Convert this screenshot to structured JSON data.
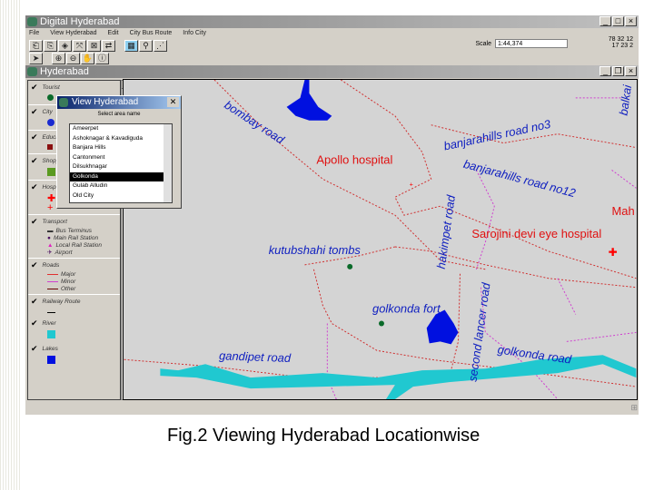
{
  "app": {
    "title": "Digital Hyderabad",
    "menu": [
      "File",
      "View Hyderabad",
      "Edit",
      "City Bus Route",
      "Info City"
    ],
    "scale_label": "Scale",
    "scale_value": "1:44,374",
    "coords": [
      "78 32 12",
      "17 23 2"
    ]
  },
  "subwindow": {
    "title": "Hyderabad"
  },
  "legend": {
    "groups": [
      {
        "label": "Tourist",
        "swatch": "#0a6a2a"
      },
      {
        "label": "City",
        "swatch": "#1a2ad0"
      },
      {
        "label": "Education",
        "swatch": "#8a1010"
      },
      {
        "label": "Shopping",
        "swatch": "#5a9a20"
      },
      {
        "label": "Hospital",
        "swatch": "#ff0000"
      }
    ],
    "transport": {
      "label": "Transport",
      "items": [
        "Bus Terminus",
        "Main Rail Station",
        "Local Rail Station",
        "Airport"
      ]
    },
    "roads": {
      "label": "Roads",
      "items": [
        "Major",
        "Minor",
        "Other"
      ]
    },
    "railway": "Railway Route",
    "river": "River",
    "lakes": "Lakes"
  },
  "dialog": {
    "title": "View Hyderabad",
    "label": "Select area name",
    "areas": [
      "Ameerpet",
      "Ashoknagar & Kavadiguda",
      "Banjara Hills",
      "Cantonment",
      "Dilsukhnagar",
      "Golkonda",
      "Gulab Alludin",
      "Old City"
    ],
    "selected": "Golkonda"
  },
  "map": {
    "labels": {
      "bombay": "bombay road",
      "apollo": "Apollo hospital",
      "bh3": "banjarahills road no3",
      "bh12": "banjarahills road no12",
      "hakimpet": "hakimpet road",
      "sarojini": "Sarojini devi eye hospital",
      "mah": "Mah",
      "kutub": "kutubshahi tombs",
      "golkonda_fort": "golkonda fort",
      "second": "second lancer road",
      "gandipet": "gandipet road",
      "golkonda_road": "golkonda road",
      "balkai": "balkai"
    }
  },
  "caption": "Fig.2 Viewing Hyderabad Locationwise"
}
